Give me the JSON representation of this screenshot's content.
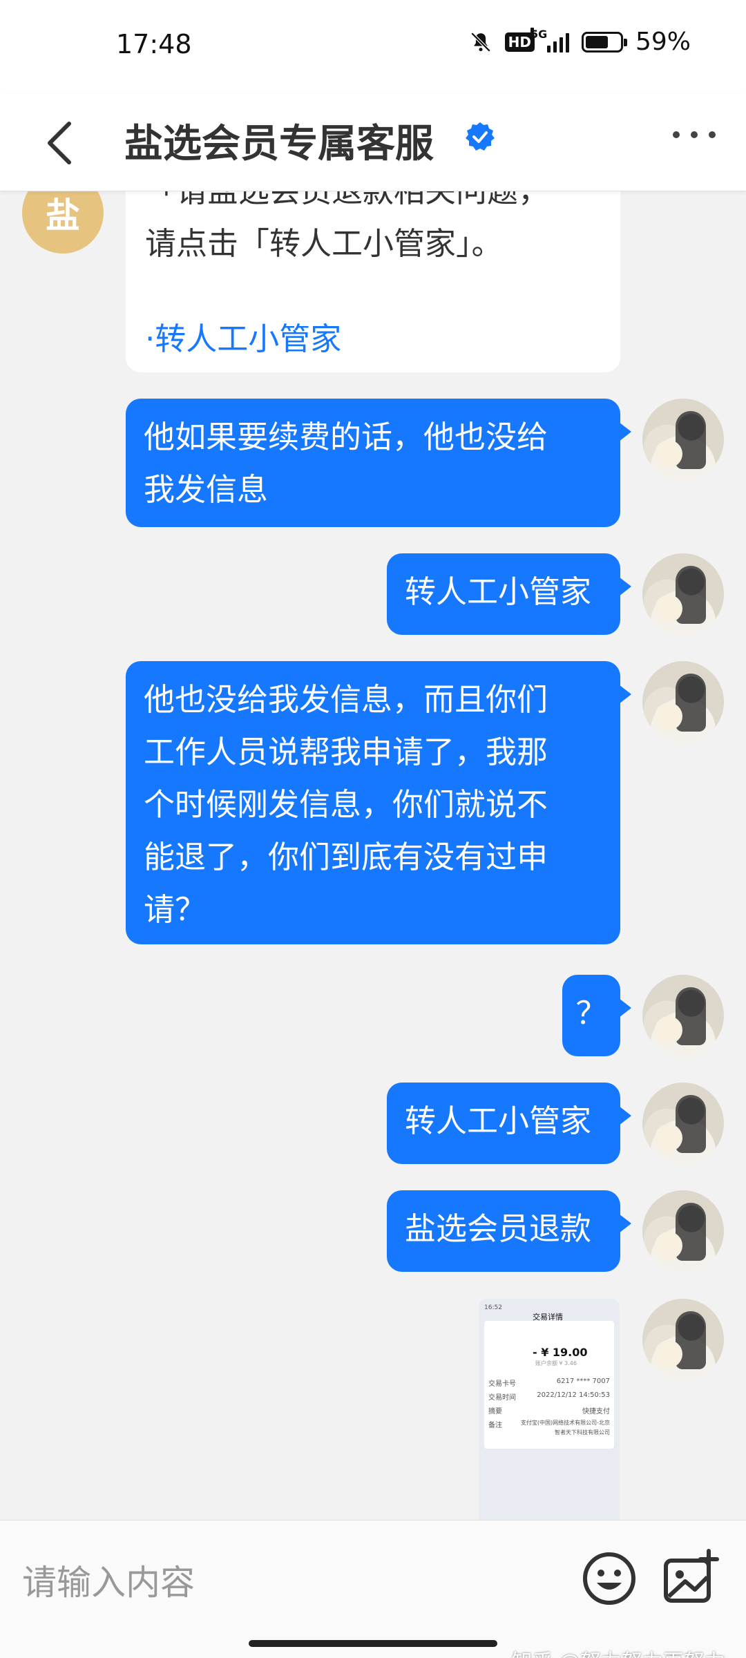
{
  "status_bar": {
    "time": "17:48",
    "battery": "59%",
    "hd": "HD",
    "network": "5G"
  },
  "header": {
    "title": "盐选会员专属客服"
  },
  "bot_message": {
    "partial_line": "「请盐选会员退款相关问题，",
    "line": "请点击「转人工小管家」。",
    "link": "·转人工小管家"
  },
  "messages": [
    {
      "lines": [
        "他如果要续费的话，他也没给",
        "我发信息"
      ]
    },
    {
      "lines": [
        "转人工小管家"
      ]
    },
    {
      "lines": [
        "他也没给我发信息，而且你们",
        "工作人员说帮我申请了，我那",
        "个时候刚发信息，你们就说不",
        "能退了，你们到底有没有过申",
        "请？"
      ]
    },
    {
      "lines": [
        "？"
      ]
    },
    {
      "lines": [
        "转人工小管家"
      ]
    },
    {
      "lines": [
        "盐选会员退款"
      ]
    }
  ],
  "image_message": {
    "header": "交易详情",
    "amount": "- ¥ 19.00",
    "sub": "账户余额 ¥ 3.46",
    "rows": [
      {
        "k": "交易卡号",
        "v": "6217 **** 7007"
      },
      {
        "k": "交易时间",
        "v": "2022/12/12 14:50:53"
      },
      {
        "k": "摘要",
        "v": "快捷支付"
      },
      {
        "k": "备注",
        "v": "支付宝(中国)网络技术有限公司-北京"
      },
      {
        "k": "",
        "v": "智者天下科技有限公司"
      }
    ]
  },
  "input": {
    "placeholder": "请输入内容"
  },
  "watermark": "知乎 @努力努力再努力",
  "colors": {
    "accent": "#1677ff",
    "bg": "#f2f2f2"
  }
}
